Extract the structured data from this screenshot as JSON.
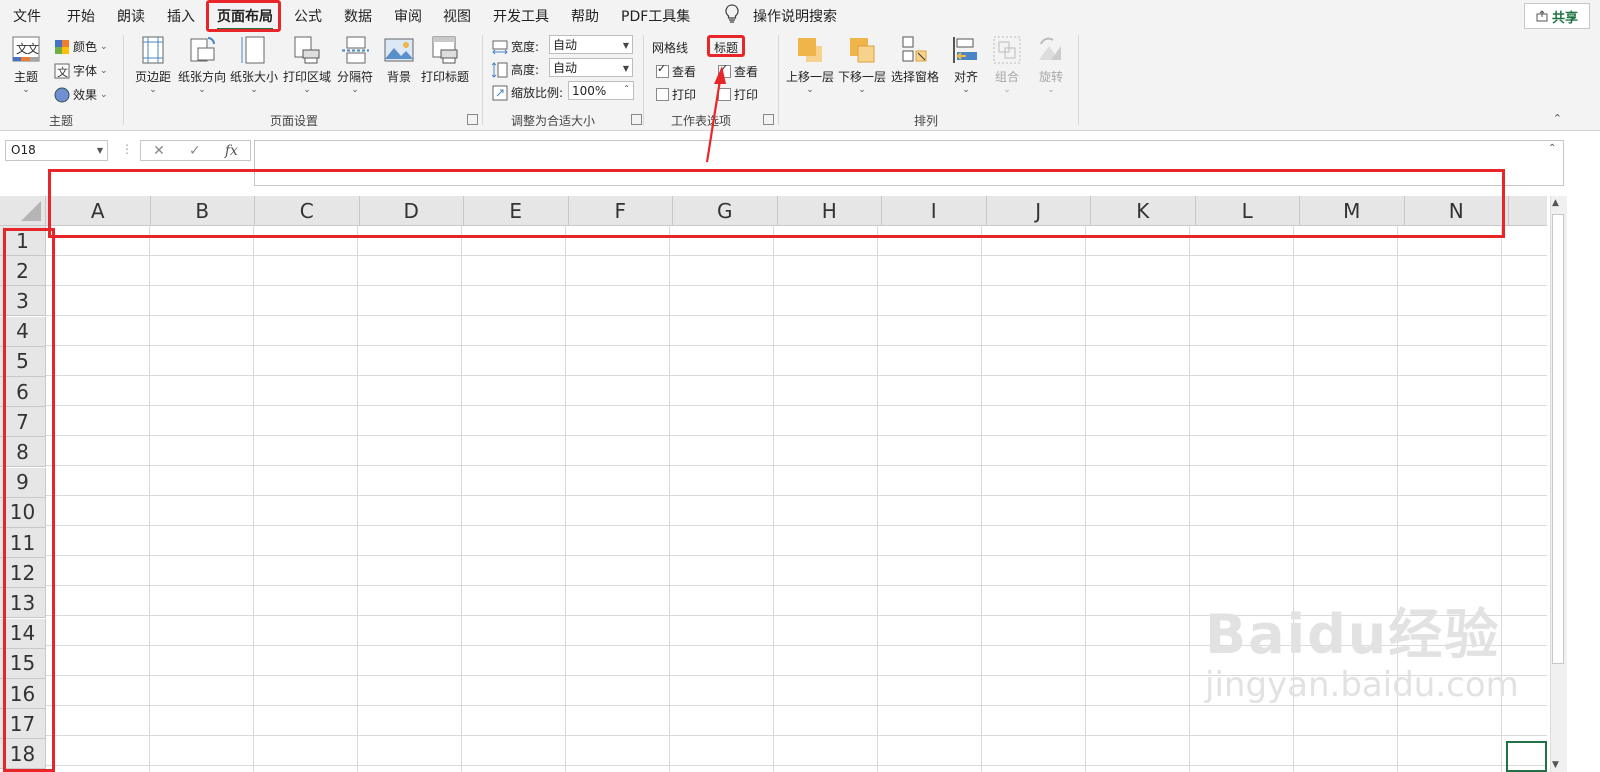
{
  "tabs": [
    "文件",
    "开始",
    "朗读",
    "插入",
    "页面布局",
    "公式",
    "数据",
    "审阅",
    "视图",
    "开发工具",
    "帮助",
    "PDF工具集"
  ],
  "active_tab": "页面布局",
  "tell_me": "操作说明搜索",
  "share_label": "共享",
  "ribbon": {
    "theme": {
      "main_label": "主题",
      "colors": "颜色",
      "fonts": "字体",
      "effects": "效果",
      "group": "主题"
    },
    "page_setup": {
      "margins": "页边距",
      "orientation": "纸张方向",
      "size": "纸张大小",
      "print_area": "打印区域",
      "breaks": "分隔符",
      "background": "背景",
      "print_titles": "打印标题",
      "group": "页面设置"
    },
    "scale": {
      "width_label": "宽度:",
      "width_value": "自动",
      "height_label": "高度:",
      "height_value": "自动",
      "scale_label": "缩放比例:",
      "scale_value": "100%",
      "group": "调整为合适大小"
    },
    "sheet_options": {
      "gridlines": "网格线",
      "headings": "标题",
      "view": "查看",
      "print": "打印",
      "group": "工作表选项",
      "gridlines_view": true,
      "gridlines_print": false,
      "headings_view": true,
      "headings_print": false
    },
    "arrange": {
      "bring_forward": "上移一层",
      "send_backward": "下移一层",
      "selection_pane": "选择窗格",
      "align": "对齐",
      "group_btn": "组合",
      "rotate": "旋转",
      "group": "排列"
    }
  },
  "name_box": "O18",
  "formula_icons": {
    "cancel": "✕",
    "enter": "✓",
    "fx": "fx"
  },
  "formula_value": "",
  "columns": [
    "A",
    "B",
    "C",
    "D",
    "E",
    "F",
    "G",
    "H",
    "I",
    "J",
    "K",
    "L",
    "M",
    "N"
  ],
  "rows": [
    "1",
    "2",
    "3",
    "4",
    "5",
    "6",
    "7",
    "8",
    "9",
    "10",
    "11",
    "12",
    "13",
    "14",
    "15",
    "16",
    "17",
    "18"
  ],
  "watermark": {
    "brand": "Baidu经验",
    "url": "jingyan.baidu.com"
  }
}
